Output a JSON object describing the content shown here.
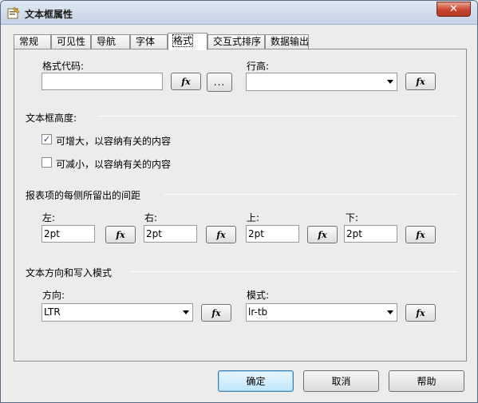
{
  "window": {
    "title": "文本框属性",
    "close_symbol": "✕"
  },
  "tabs": [
    {
      "label": "常规"
    },
    {
      "label": "可见性"
    },
    {
      "label": "导航"
    },
    {
      "label": "字体"
    },
    {
      "label": "格式",
      "active": true
    },
    {
      "label": "交互式排序"
    },
    {
      "label": "数据输出"
    }
  ],
  "format": {
    "code_label": "格式代码:",
    "code_value": "",
    "fx_label": "fx",
    "ellipsis_label": "...",
    "line_height_label": "行高:",
    "line_height_value": ""
  },
  "textbox_height": {
    "group_label": "文本框高度:",
    "can_grow_label": "可增大，以容纳有关的内容",
    "can_grow_checked": true,
    "can_shrink_label": "可减小，以容纳有关的内容",
    "can_shrink_checked": false
  },
  "padding": {
    "group_label": "报表项的每侧所留出的间距",
    "left_label": "左:",
    "left_value": "2pt",
    "right_label": "右:",
    "right_value": "2pt",
    "top_label": "上:",
    "top_value": "2pt",
    "bottom_label": "下:",
    "bottom_value": "2pt"
  },
  "direction": {
    "group_label": "文本方向和写入模式",
    "direction_label": "方向:",
    "direction_value": "LTR",
    "mode_label": "模式:",
    "mode_value": "lr-tb"
  },
  "buttons": {
    "ok": "确定",
    "cancel": "取消",
    "help": "帮助"
  }
}
